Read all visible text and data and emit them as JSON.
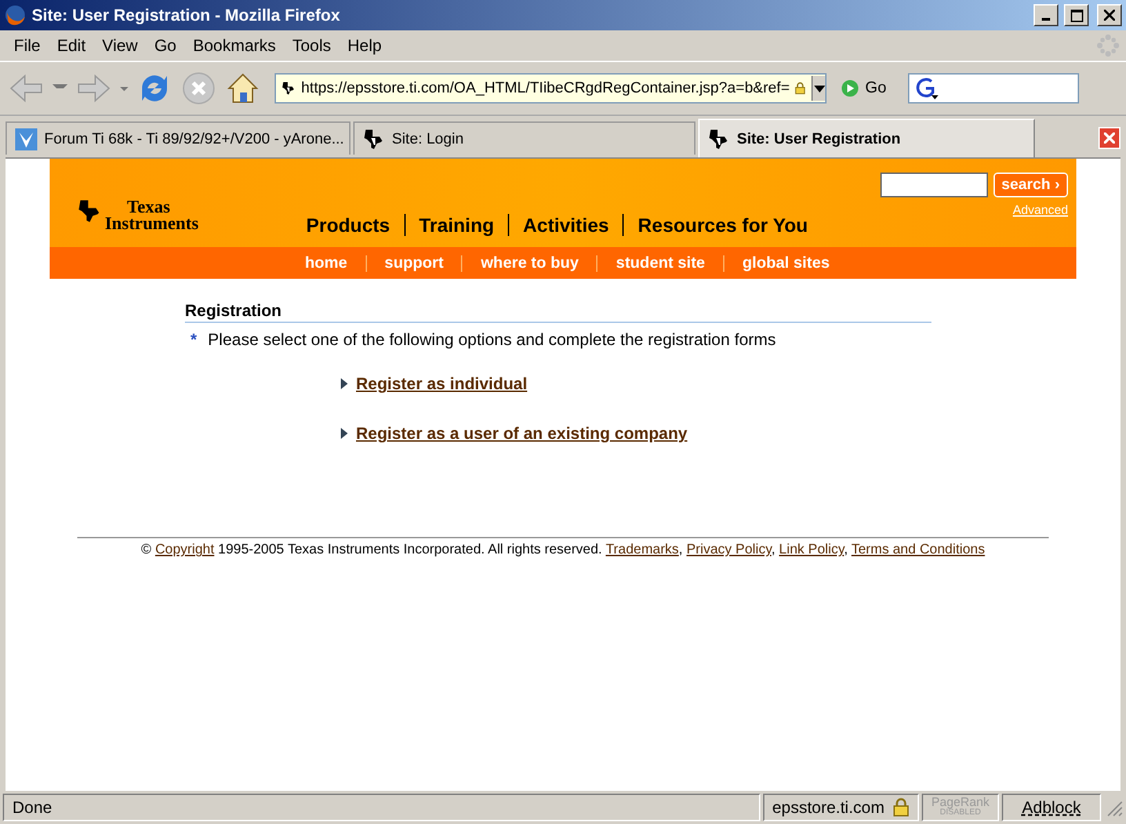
{
  "window": {
    "title": "Site:  User Registration - Mozilla Firefox"
  },
  "menu": [
    "File",
    "Edit",
    "View",
    "Go",
    "Bookmarks",
    "Tools",
    "Help"
  ],
  "toolbar": {
    "url": "https://epsstore.ti.com/OA_HTML/TIibeCRgdRegContainer.jsp?a=b&ref=",
    "go": "Go"
  },
  "tabs": [
    {
      "label": "Forum Ti 68k - Ti 89/92/92+/V200 - yArone...",
      "kind": "forum",
      "selected": false
    },
    {
      "label": "Site:  Login",
      "kind": "ti",
      "selected": false
    },
    {
      "label": "Site:  User Registration",
      "kind": "ti",
      "selected": true
    }
  ],
  "header": {
    "logo": [
      "Texas",
      "Instruments"
    ],
    "nav": [
      "Products",
      "Training",
      "Activities",
      "Resources for You"
    ],
    "search_button": "search ›",
    "advanced": "Advanced",
    "subnav": [
      "home",
      "support",
      "where to buy",
      "student site",
      "global sites"
    ]
  },
  "registration": {
    "heading": "Registration",
    "bullet": "*",
    "instruction": "Please select one of the following options and complete the registration forms",
    "options": [
      "Register as individual",
      "Register as a user of an existing company"
    ]
  },
  "footer": [
    {
      "kind": "text",
      "text": "© "
    },
    {
      "kind": "link",
      "text": "Copyright"
    },
    {
      "kind": "text",
      "text": " 1995-2005 Texas Instruments Incorporated. All rights reserved. "
    },
    {
      "kind": "link",
      "text": "Trademarks"
    },
    {
      "kind": "text",
      "text": ", "
    },
    {
      "kind": "link",
      "text": "Privacy Policy"
    },
    {
      "kind": "text",
      "text": ", "
    },
    {
      "kind": "link",
      "text": "Link Policy"
    },
    {
      "kind": "text",
      "text": ", "
    },
    {
      "kind": "link",
      "text": "Terms and Conditions"
    }
  ],
  "status": {
    "text": "Done",
    "host": "epsstore.ti.com",
    "pagerank": [
      "PageRank",
      "DISABLED"
    ],
    "adblock": "Adblock"
  }
}
